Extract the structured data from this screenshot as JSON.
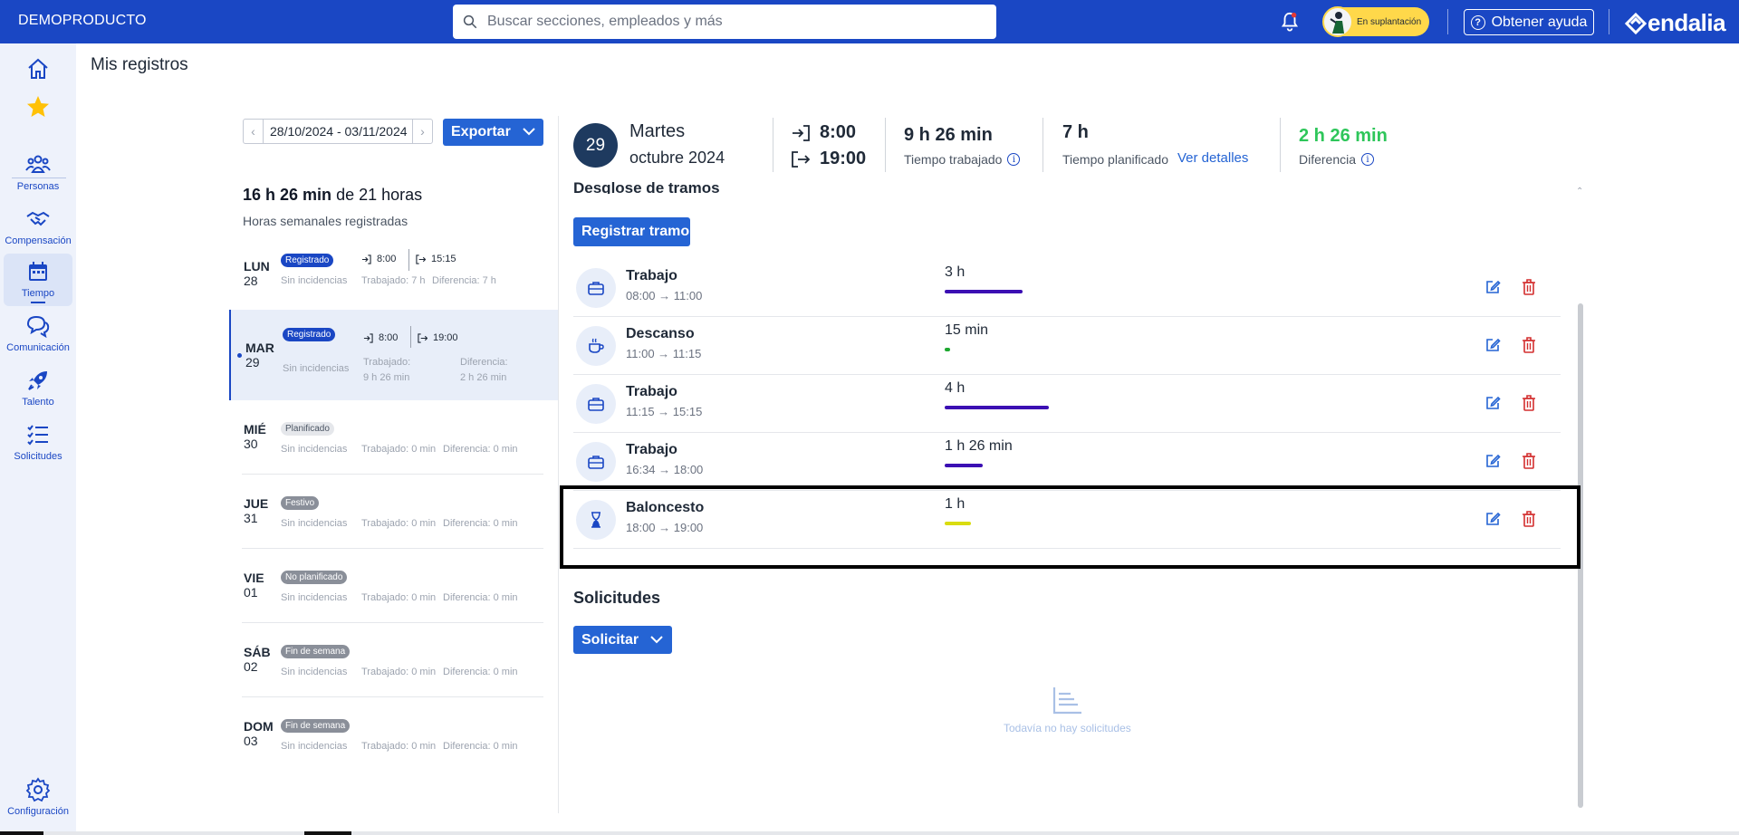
{
  "topbar": {
    "brand": "DEMOPRODUCTO",
    "search_placeholder": "Buscar secciones, empleados y más",
    "impersonation": "En suplantación",
    "help": "Obtener ayuda",
    "logo": "endalia"
  },
  "nav": {
    "items": [
      {
        "label": "Personas",
        "icon": "people-icon"
      },
      {
        "label": "Compensación",
        "icon": "handshake-icon"
      },
      {
        "label": "Tiempo",
        "icon": "calendar-icon"
      },
      {
        "label": "Comunicación",
        "icon": "chat-icon"
      },
      {
        "label": "Talento",
        "icon": "rocket-icon"
      },
      {
        "label": "Solicitudes",
        "icon": "checklist-icon"
      }
    ],
    "settings": "Configuración"
  },
  "page": {
    "title": "Mis registros"
  },
  "week": {
    "range": "28/10/2024 - 03/11/2024",
    "export": "Exportar",
    "summary_bold": "16 h 26 min",
    "summary_rest": "de 21 horas",
    "subtitle": "Horas semanales registradas"
  },
  "days": [
    {
      "name": "LUN",
      "num": "28",
      "badge": "Registrado",
      "sinc": "Sin incidencias",
      "in": "8:00",
      "out": "15:15",
      "trab": "Trabajado: 7 h",
      "dif": "Diferencia: 7 h"
    },
    {
      "name": "MAR",
      "num": "29",
      "badge": "Registrado",
      "sinc": "Sin incidencias",
      "in": "8:00",
      "out": "19:00",
      "trab1": "Trabajado:",
      "trab2": "9 h 26 min",
      "dif1": "Diferencia:",
      "dif2": "2 h 26 min"
    },
    {
      "name": "MIÉ",
      "num": "30",
      "badge": "Planificado",
      "sinc": "Sin incidencias",
      "trab": "Trabajado: 0 min",
      "dif": "Diferencia: 0 min"
    },
    {
      "name": "JUE",
      "num": "31",
      "badge": "Festivo",
      "sinc": "Sin incidencias",
      "trab": "Trabajado: 0 min",
      "dif": "Diferencia: 0 min"
    },
    {
      "name": "VIE",
      "num": "01",
      "badge": "No planificado",
      "sinc": "Sin incidencias",
      "trab": "Trabajado: 0 min",
      "dif": "Diferencia: 0 min"
    },
    {
      "name": "SÁB",
      "num": "02",
      "badge": "Fin de semana",
      "sinc": "Sin incidencias",
      "trab": "Trabajado: 0 min",
      "dif": "Diferencia: 0 min"
    },
    {
      "name": "DOM",
      "num": "03",
      "badge": "Fin de semana",
      "sinc": "Sin incidencias",
      "trab": "Trabajado: 0 min",
      "dif": "Diferencia: 0 min"
    }
  ],
  "detail": {
    "day_num": "29",
    "weekday": "Martes",
    "month": "octubre 2024",
    "in": "8:00",
    "out": "19:00",
    "worked": "9 h 26 min",
    "worked_label": "Tiempo trabajado",
    "planned": "7 h",
    "planned_label": "Tiempo planificado",
    "details_link": "Ver detalles",
    "diff": "2 h 26 min",
    "diff_label": "Diferencia",
    "section_title": "Desglose de tramos",
    "register_btn": "Registrar tramo"
  },
  "tramos": [
    {
      "name": "Trabajo",
      "range": "08:00 → 11:00",
      "duration": "3 h",
      "icon": "briefcase-icon",
      "color": "#3b0fb3",
      "fill": 0.27
    },
    {
      "name": "Descanso",
      "range": "11:00 → 11:15",
      "duration": "15 min",
      "icon": "coffee-icon",
      "color": "#1fa831",
      "fill": 0.02
    },
    {
      "name": "Trabajo",
      "range": "11:15 → 15:15",
      "duration": "4 h",
      "icon": "briefcase-icon",
      "color": "#3b0fb3",
      "fill": 0.36
    },
    {
      "name": "Trabajo",
      "range": "16:34 → 18:00",
      "duration": "1 h 26 min",
      "icon": "briefcase-icon",
      "color": "#3b0fb3",
      "fill": 0.13
    },
    {
      "name": "Baloncesto",
      "range": "18:00 → 19:00",
      "duration": "1 h",
      "icon": "hourglass-icon",
      "color": "#d9dc10",
      "fill": 0.09
    }
  ],
  "requests": {
    "title": "Solicitudes",
    "button": "Solicitar",
    "empty": "Todavía no hay solicitudes"
  },
  "colors": {
    "brand": "#1a47c4",
    "button": "#2564d4",
    "positive": "#2ec65a",
    "delete": "#d32f2f"
  }
}
